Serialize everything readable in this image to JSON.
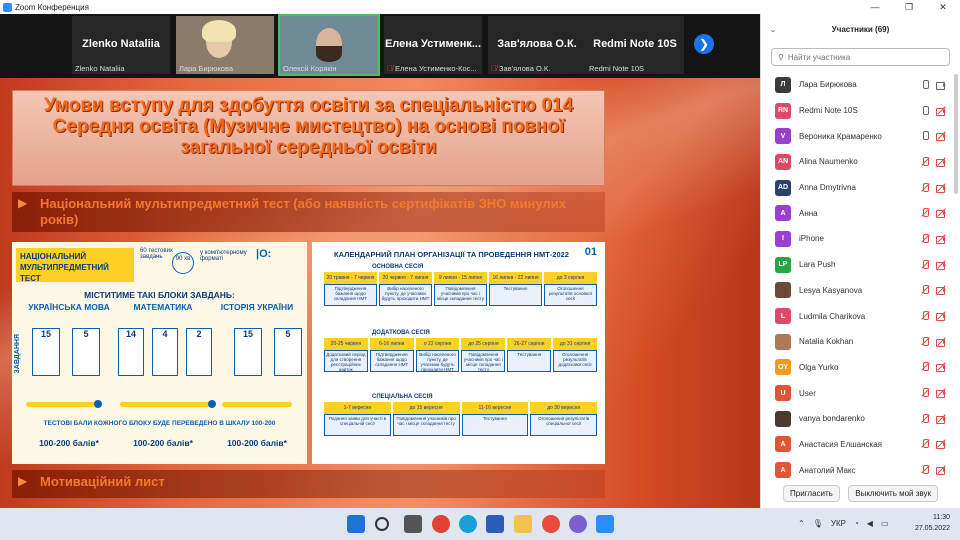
{
  "window": {
    "title": "Zoom Конференция",
    "controls": [
      "—",
      "❐",
      "✕"
    ]
  },
  "thumbnails": [
    {
      "big_name": "Zlenko Nataliia",
      "name": "Zlenko Nataliia",
      "muted": false,
      "video": false
    },
    {
      "big_name": "",
      "name": "Лара Бирюкова",
      "muted": false,
      "video": true
    },
    {
      "big_name": "",
      "name": "Олексй Корякін",
      "muted": false,
      "video": true,
      "active": true
    },
    {
      "big_name": "Елена Устименк...",
      "name": "Елена Устименко-Кос...",
      "muted": true,
      "video": false
    },
    {
      "big_name": "Зав'ялова О.К.",
      "name": "Зав'ялова О.К.",
      "muted": true,
      "video": false
    },
    {
      "big_name": "Redmi Note 10S",
      "name": "Redmi Note 10S",
      "muted": false,
      "video": false
    }
  ],
  "slide": {
    "title": "Умови вступу для здобуття освіти за спеціальністю 014 Середня освіта (Музичне мистецтво) на основі повної загальної середньої освіти",
    "bullets": [
      "Національний мультипредметний тест (або наявність  сертифікатів ЗНО минулих років)",
      "Мотиваційний лист"
    ],
    "left_panel": {
      "heading": "НАЦІОНАЛЬНИЙ МУЛЬТИПРЕДМЕТНИЙ ТЕСТ",
      "opt1": "60 тестових завдань",
      "opt2": "у комп'ютерному форматі",
      "time": "90 хв",
      "subtitle": "МІСТИТИМЕ ТАКІ БЛОКИ ЗАВДАНЬ:",
      "subjects": [
        "УКРАЇНСЬКА МОВА",
        "МАТЕМАТИКА",
        "ІСТОРІЯ УКРАЇНИ"
      ],
      "counts": [
        [
          "15",
          "5"
        ],
        [
          "14",
          "4",
          "2"
        ],
        [
          "15",
          "5"
        ]
      ],
      "note": "ТЕСТОВІ БАЛИ КОЖНОГО БЛОКУ БУДЕ ПЕРЕВЕДЕНО В ШКАЛУ 100-200",
      "scores": [
        "100-200 балів*",
        "100-200 балів*",
        "100-200 балів*"
      ],
      "side_label": "ЗАВДАННЯ"
    },
    "right_panel": {
      "title": "КАЛЕНДАРНИЙ ПЛАН ОРГАНІЗАЦІЇ ТА ПРОВЕДЕННЯ НМТ-2022",
      "logo": "01",
      "sessions": [
        "ОСНОВНА СЕСІЯ",
        "ДОДАТКОВА СЕСІЯ",
        "СПЕЦІАЛЬНА СЕСІЯ"
      ],
      "row1_dates": [
        "20 травня - 7 червня",
        "20 червня - 7 липня",
        "9 липня - 15 липня",
        "16 липня - 22 липня",
        "до 3 серпня"
      ],
      "row1_text": [
        "Підтвердження бажання щодо складання НМТ",
        "Вибір населеного пункту, де учасники будуть проходити НМТ",
        "Повідомлення учасників про час і місце складання тесту",
        "Тестування",
        "Оголошення результатів основної сесії"
      ],
      "row2_dates": [
        "20-25 червня",
        "6-16 липня",
        "о 22 серпня",
        "до 25 серпня",
        "26-27 серпня",
        "до 31 серпня"
      ],
      "row2_text": [
        "Додатковий період для створення реєстраційних карток",
        "Підтвердження бажання щодо складання НМТ",
        "Вибір населеного пункту, де учасники будуть проходити НМТ",
        "Повідомлення учасників про час і місце складання тесту",
        "Тестування",
        "Оголошення результатів додаткової сесії"
      ],
      "row3_dates": [
        "1-7 вересня",
        "до 15 вересня",
        "11-16 вересня",
        "до 30 вересня"
      ],
      "row3_text": [
        "Подання заяви для участі в спеціальній сесії",
        "Повідомлення учасників про час і місце складання тесту",
        "Тестування",
        "Оголошення результатів спеціальної сесії"
      ]
    }
  },
  "participants": {
    "header": "Участники (69)",
    "search_placeholder": "Найти участника",
    "list": [
      {
        "initials": "Л",
        "name": "Лара Бирюкова",
        "color": "#3b3b3b",
        "mic_off": false,
        "cam_off": false
      },
      {
        "initials": "RN",
        "name": "Redmi Note 10S",
        "color": "#e0486a",
        "mic_off": false,
        "cam_off": true
      },
      {
        "initials": "V",
        "name": "Вероника Крамаренко",
        "color": "#9b3fd1",
        "mic_off": false,
        "cam_off": true
      },
      {
        "initials": "AN",
        "name": "Alina Naumenko",
        "color": "#e0486a",
        "mic_off": true,
        "cam_off": true
      },
      {
        "initials": "AD",
        "name": "Anna Dmytrivna",
        "color": "#2a4470",
        "mic_off": true,
        "cam_off": true
      },
      {
        "initials": "A",
        "name": "Анна",
        "color": "#9b3fd1",
        "mic_off": true,
        "cam_off": true
      },
      {
        "initials": "I",
        "name": "iPhone",
        "color": "#9b3fd1",
        "mic_off": true,
        "cam_off": true
      },
      {
        "initials": "LP",
        "name": "Lara Push",
        "color": "#27a645",
        "mic_off": true,
        "cam_off": true
      },
      {
        "initials": "",
        "name": "Lesya Kasyanova",
        "color": "#6b4a3a",
        "mic_off": true,
        "cam_off": true
      },
      {
        "initials": "L",
        "name": "Ludmila Charikova",
        "color": "#e0486a",
        "mic_off": true,
        "cam_off": true
      },
      {
        "initials": "",
        "name": "Natalia  Kokhan",
        "color": "#b0785a",
        "mic_off": true,
        "cam_off": true
      },
      {
        "initials": "OY",
        "name": "Olga Yurko",
        "color": "#f39a1c",
        "mic_off": true,
        "cam_off": true
      },
      {
        "initials": "U",
        "name": "User",
        "color": "#e05535",
        "mic_off": true,
        "cam_off": true
      },
      {
        "initials": "",
        "name": "vanya bondarenko",
        "color": "#4a3a30",
        "mic_off": true,
        "cam_off": true
      },
      {
        "initials": "А",
        "name": "Анастасия Елшанская",
        "color": "#e05535",
        "mic_off": true,
        "cam_off": true
      },
      {
        "initials": "А",
        "name": "Анатолий Макс",
        "color": "#e05535",
        "mic_off": true,
        "cam_off": true
      }
    ],
    "invite_label": "Пригласить",
    "mute_all_label": "Выключить мой звук"
  },
  "taskbar": {
    "language": "УКР",
    "time": "11:30",
    "date": "27.05.2022"
  }
}
